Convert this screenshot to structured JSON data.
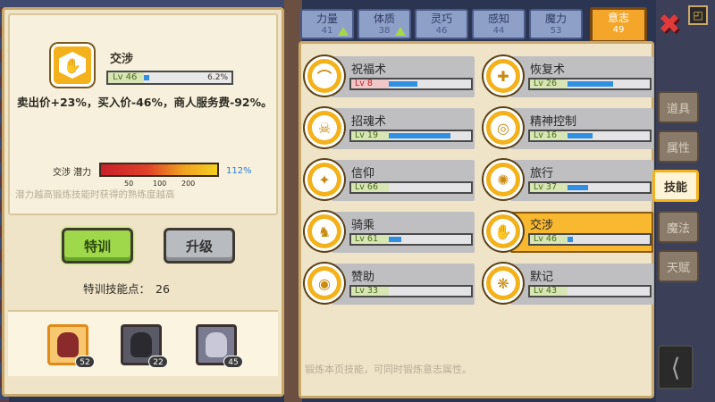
{
  "selected_skill": {
    "name": "交涉",
    "level": "Lv 46",
    "progress_pct": "6.2%",
    "progress_fraction": 0.062,
    "description": "卖出价+23%，买入价-46%，商人服务费-92%。",
    "potential_label": "交涉 潜力",
    "potential_pct": "112%",
    "potential_ticks": [
      "50",
      "100",
      "200"
    ],
    "hint": "潜力越高锻炼技能时获得的熟练度越高"
  },
  "buttons": {
    "train": "特训",
    "upgrade": "升级"
  },
  "train_points": {
    "label": "特训技能点：",
    "value": "26"
  },
  "team": [
    {
      "level": "52"
    },
    {
      "level": "22"
    },
    {
      "level": "45"
    }
  ],
  "attributes": [
    {
      "name": "力量",
      "value": "41",
      "up": true
    },
    {
      "name": "体质",
      "value": "38",
      "up": true
    },
    {
      "name": "灵巧",
      "value": "46",
      "up": false
    },
    {
      "name": "感知",
      "value": "44",
      "up": false
    },
    {
      "name": "魔力",
      "value": "53",
      "up": false
    },
    {
      "name": "意志",
      "value": "49",
      "up": false,
      "active": true
    }
  ],
  "skills": [
    {
      "name": "祝福术",
      "level": "Lv 8",
      "fill": 0.35,
      "red": true,
      "icon": "blessing-icon"
    },
    {
      "name": "恢复术",
      "level": "Lv 26",
      "fill": 0.55,
      "icon": "heal-icon"
    },
    {
      "name": "招魂术",
      "level": "Lv 19",
      "fill": 0.75,
      "icon": "skull-icon"
    },
    {
      "name": "精神控制",
      "level": "Lv 16",
      "fill": 0.3,
      "icon": "brain-control-icon"
    },
    {
      "name": "信仰",
      "level": "Lv 66",
      "fill": 0.0,
      "icon": "faith-icon"
    },
    {
      "name": "旅行",
      "level": "Lv 37",
      "fill": 0.25,
      "icon": "wheel-icon"
    },
    {
      "name": "骑乘",
      "level": "Lv 61",
      "fill": 0.15,
      "icon": "horse-icon"
    },
    {
      "name": "交涉",
      "level": "Lv 46",
      "fill": 0.06,
      "icon": "handshake-icon",
      "selected": true
    },
    {
      "name": "赞助",
      "level": "Lv 33",
      "fill": 0.0,
      "icon": "coins-icon"
    },
    {
      "name": "默记",
      "level": "Lv 43",
      "fill": 0.0,
      "icon": "memory-brain-icon"
    }
  ],
  "footer_hint": "锻炼本页技能，可同时锻炼意志属性。",
  "side_tabs": [
    {
      "label": "道具"
    },
    {
      "label": "属性"
    },
    {
      "label": "技能",
      "active": true
    },
    {
      "label": "魔法"
    },
    {
      "label": "天赋"
    }
  ],
  "colors": {
    "accent": "#f3b21c",
    "progress": "#2f8fe0",
    "train_button": "#9fd84a",
    "close": "#e23a3a"
  }
}
